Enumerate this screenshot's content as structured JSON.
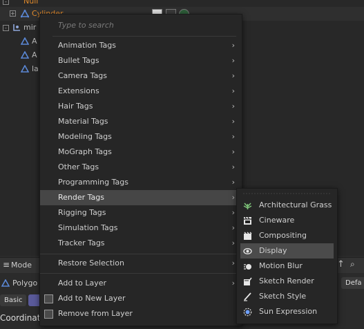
{
  "tree": {
    "row1_label": "Null",
    "row2_label": "Cylinder",
    "row3_label": "mir",
    "row4_label": "A",
    "row5_label": "A",
    "row6_label": "la"
  },
  "menu": {
    "search_placeholder": "Type to search",
    "items": [
      {
        "label": "Animation Tags",
        "arrow": "›"
      },
      {
        "label": "Bullet Tags",
        "arrow": "›"
      },
      {
        "label": "Camera Tags",
        "arrow": "›"
      },
      {
        "label": "Extensions",
        "arrow": "›"
      },
      {
        "label": "Hair Tags",
        "arrow": "›"
      },
      {
        "label": "Material Tags",
        "arrow": "›"
      },
      {
        "label": "Modeling Tags",
        "arrow": "›"
      },
      {
        "label": "MoGraph Tags",
        "arrow": "›"
      },
      {
        "label": "Other Tags",
        "arrow": "›"
      },
      {
        "label": "Programming Tags",
        "arrow": "›"
      },
      {
        "label": "Render Tags",
        "arrow": "›"
      },
      {
        "label": "Rigging Tags",
        "arrow": "›"
      },
      {
        "label": "Simulation Tags",
        "arrow": "›"
      },
      {
        "label": "Tracker Tags",
        "arrow": "›"
      }
    ],
    "restore_selection": {
      "label": "Restore Selection",
      "arrow": "›"
    },
    "add_to_layer": {
      "label": "Add to Layer",
      "arrow": "›"
    },
    "add_to_new_layer": {
      "label": "Add to New Layer"
    },
    "remove_from_layer": {
      "label": "Remove from Layer"
    }
  },
  "submenu": {
    "items": [
      {
        "label": "Architectural Grass",
        "icon": "grass-icon"
      },
      {
        "label": "Cineware",
        "icon": "cineware-icon"
      },
      {
        "label": "Compositing",
        "icon": "compositing-icon"
      },
      {
        "label": "Display",
        "icon": "display-icon"
      },
      {
        "label": "Motion Blur",
        "icon": "motion-blur-icon"
      },
      {
        "label": "Sketch Render",
        "icon": "sketch-render-icon"
      },
      {
        "label": "Sketch Style",
        "icon": "sketch-style-icon"
      },
      {
        "label": "Sun Expression",
        "icon": "sun-expression-icon"
      }
    ]
  },
  "bottom": {
    "mode_label": "Mode",
    "polygon_label": "Polygo",
    "basic_label": "Basic",
    "coordinate_label": "Coordinate",
    "default_label": "Defa"
  },
  "colors": {
    "orange": "#e08a2c",
    "accent_blue": "#5b88d6"
  }
}
